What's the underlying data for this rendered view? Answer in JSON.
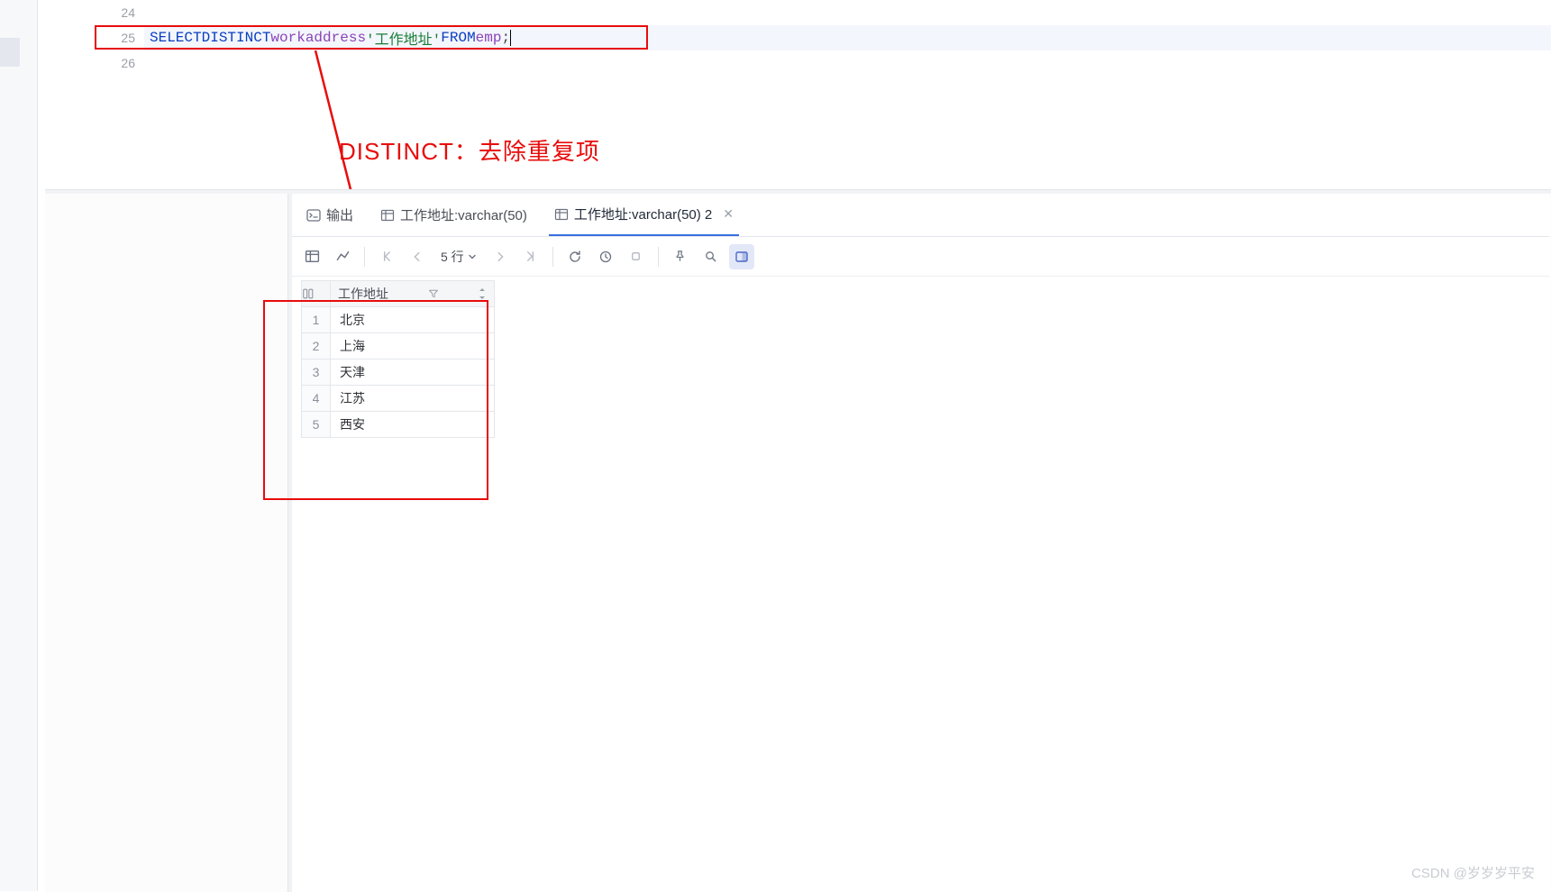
{
  "editor": {
    "lines": [
      {
        "num": "24",
        "tokens": []
      },
      {
        "num": "25",
        "check": true,
        "highlight": true,
        "sql": {
          "select": "SELECT",
          "distinct": "DISTINCT",
          "col": "workaddress",
          "alias": "'工作地址'",
          "from": "FROM",
          "table": "emp",
          "semi": ";"
        }
      },
      {
        "num": "26",
        "tokens": []
      }
    ]
  },
  "annotation": {
    "text": "DISTINCT：去除重复项"
  },
  "tabs": {
    "output": {
      "label": "输出"
    },
    "tab1": {
      "label": "工作地址:varchar(50)"
    },
    "tab2": {
      "label": "工作地址:varchar(50) 2"
    }
  },
  "toolbar": {
    "rows_label": "5 行"
  },
  "grid": {
    "column": "工作地址",
    "rows": [
      {
        "n": "1",
        "v": "北京"
      },
      {
        "n": "2",
        "v": "上海"
      },
      {
        "n": "3",
        "v": "天津"
      },
      {
        "n": "4",
        "v": "江苏"
      },
      {
        "n": "5",
        "v": "西安"
      }
    ]
  },
  "watermark": "CSDN @岁岁岁平安"
}
